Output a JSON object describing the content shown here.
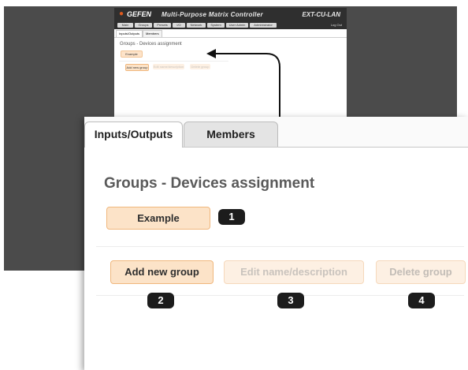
{
  "mini": {
    "logo_text": "GEFEN",
    "title": "Multi-Purpose Matrix Controller",
    "model": "EXT-CU-LAN",
    "nav": [
      "Main",
      "Groups",
      "Presets",
      "I/O",
      "Network",
      "System",
      "User Admin",
      "Administrator"
    ],
    "logout": "Log Out",
    "tabs": [
      "Inputs/Outputs",
      "Members"
    ],
    "heading": "Groups - Devices assignment",
    "example": "Example",
    "buttons": [
      "Add new group",
      "Edit name/description",
      "Delete group"
    ]
  },
  "tabs": {
    "io": "Inputs/Outputs",
    "members": "Members"
  },
  "heading": "Groups - Devices assignment",
  "buttons": {
    "example": "Example",
    "add": "Add new group",
    "edit": "Edit name/description",
    "delete": "Delete group"
  },
  "callouts": {
    "one": "1",
    "two": "2",
    "three": "3",
    "four": "4"
  },
  "colors": {
    "accent": "#fce3c8",
    "accent_border": "#f0b77d",
    "disabled_text": "#c9c3bd",
    "badge": "#1c1c1c"
  }
}
